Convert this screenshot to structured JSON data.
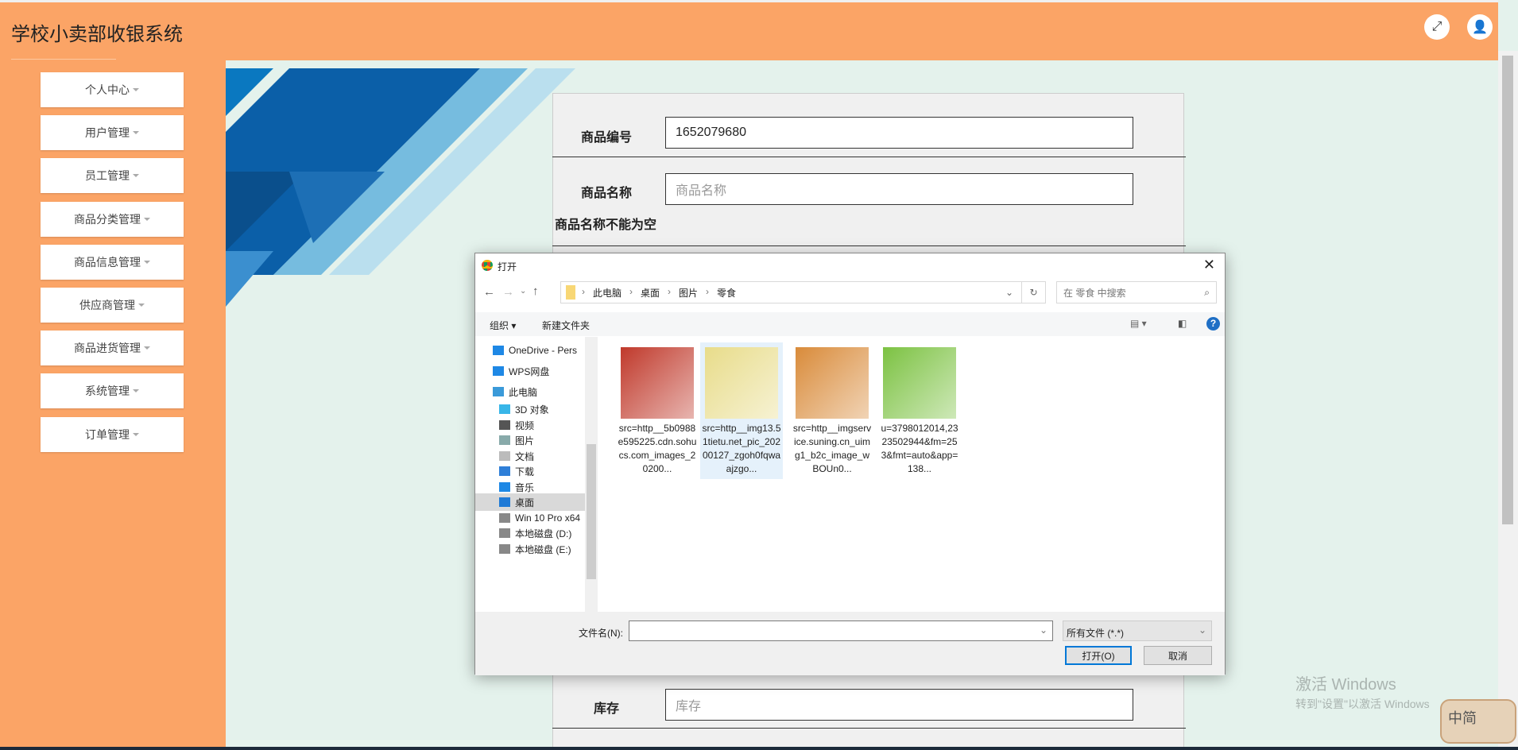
{
  "header": {
    "title": "学校小卖部收银系统",
    "fullscreen_icon": "expand-icon",
    "user_icon": "user-icon"
  },
  "sidebar": {
    "items": [
      {
        "label": "个人中心"
      },
      {
        "label": "用户管理"
      },
      {
        "label": "员工管理"
      },
      {
        "label": "商品分类管理"
      },
      {
        "label": "商品信息管理"
      },
      {
        "label": "供应商管理"
      },
      {
        "label": "商品进货管理"
      },
      {
        "label": "系统管理"
      },
      {
        "label": "订单管理"
      }
    ]
  },
  "form": {
    "code_label": "商品编号",
    "code_value": "1652079680",
    "name_label": "商品名称",
    "name_placeholder": "商品名称",
    "name_error": "商品名称不能为空",
    "stock_label": "库存",
    "stock_placeholder": "库存"
  },
  "dialog": {
    "title": "打开",
    "breadcrumb": [
      "此电脑",
      "桌面",
      "图片",
      "零食"
    ],
    "search_placeholder": "在 零食 中搜索",
    "organize": "组织",
    "new_folder": "新建文件夹",
    "nav": [
      {
        "label": "OneDrive - Pers",
        "icon": "cloud-icon"
      },
      {
        "label": "WPS网盘",
        "icon": "cloud-icon"
      },
      {
        "label": "此电脑",
        "icon": "computer-icon"
      },
      {
        "label": "3D 对象",
        "icon": "cube-icon"
      },
      {
        "label": "视频",
        "icon": "video-icon"
      },
      {
        "label": "图片",
        "icon": "picture-icon"
      },
      {
        "label": "文档",
        "icon": "document-icon"
      },
      {
        "label": "下载",
        "icon": "download-icon"
      },
      {
        "label": "音乐",
        "icon": "music-icon"
      },
      {
        "label": "桌面",
        "icon": "desktop-icon",
        "selected": true
      },
      {
        "label": "Win 10 Pro x64",
        "icon": "drive-icon"
      },
      {
        "label": "本地磁盘 (D:)",
        "icon": "drive-icon"
      },
      {
        "label": "本地磁盘 (E:)",
        "icon": "drive-icon"
      }
    ],
    "files": [
      {
        "name": "src=http__5b0988e595225.cdn.sohucs.com_images_20200...",
        "color": "#c0392b"
      },
      {
        "name": "src=http__img13.51tietu.net_pic_20200127_zgoh0fqwaajzgo...",
        "color": "#e8dc8a",
        "selected": true
      },
      {
        "name": "src=http__imgservice.suning.cn_uimg1_b2c_image_wBOUn0...",
        "color": "#d98b3a"
      },
      {
        "name": "u=3798012014,2323502944&fm=253&fmt=auto&app=138...",
        "color": "#7cc242"
      }
    ],
    "filename_label": "文件名(N):",
    "filename_value": "",
    "filetype": "所有文件 (*.*)",
    "open": "打开(O)",
    "cancel": "取消"
  },
  "watermark": {
    "line1": "激活 Windows",
    "line2": "转到\"设置\"以激活 Windows",
    "badge": "中简"
  }
}
